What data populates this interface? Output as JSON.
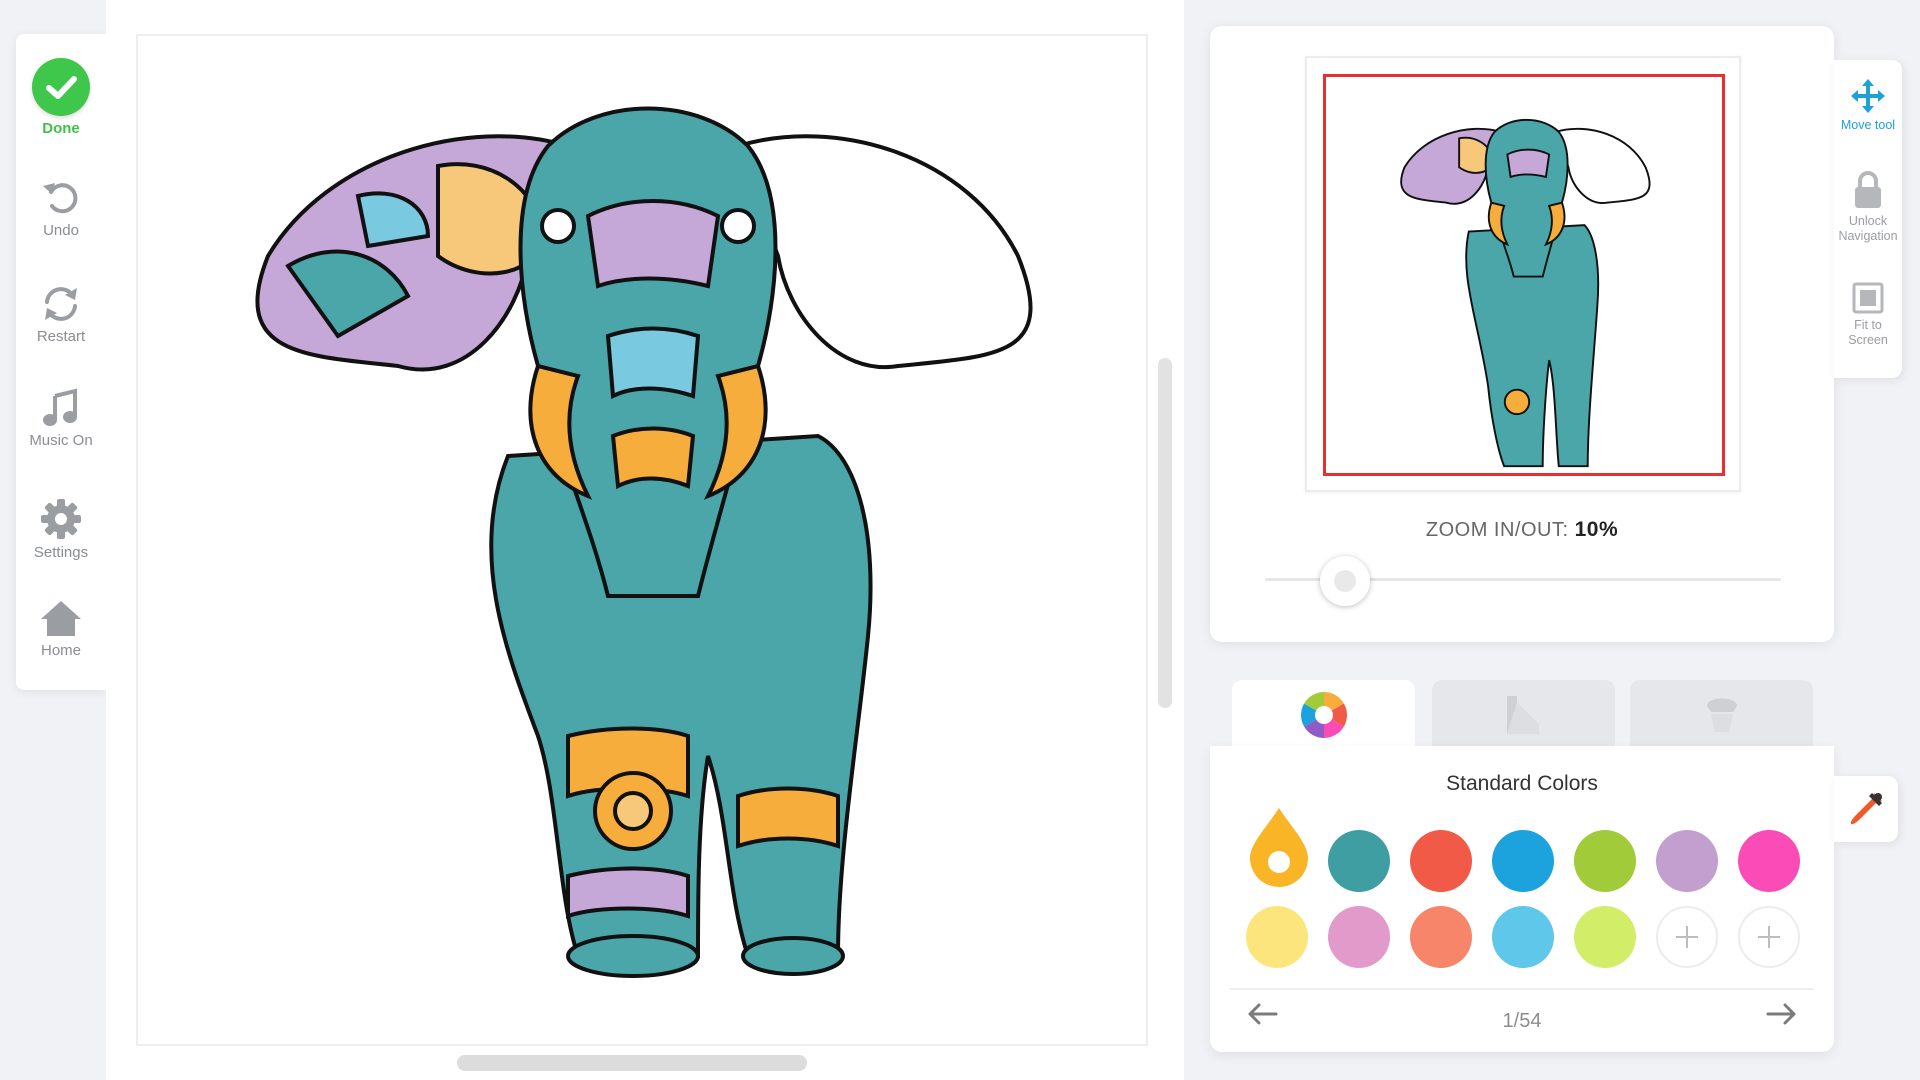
{
  "left_toolbar": {
    "items": [
      {
        "label": "Done",
        "icon": "check-icon"
      },
      {
        "label": "Undo",
        "icon": "undo-icon"
      },
      {
        "label": "Restart",
        "icon": "restart-icon"
      },
      {
        "label": "Music On",
        "icon": "music-icon"
      },
      {
        "label": "Settings",
        "icon": "gear-icon"
      },
      {
        "label": "Home",
        "icon": "home-icon"
      }
    ]
  },
  "navigator": {
    "zoom_label": "ZOOM IN/OUT:",
    "zoom_value": "10%",
    "zoom_fraction": 0.1
  },
  "right_tools": {
    "items": [
      {
        "label": "Move tool",
        "icon": "move-icon"
      },
      {
        "label": "Unlock Navigation",
        "icon": "lock-icon"
      },
      {
        "label": "Fit to Screen",
        "icon": "fit-screen-icon"
      }
    ]
  },
  "tabs": [
    {
      "name": "color-wheel",
      "icon": "color-wheel-icon",
      "active": true
    },
    {
      "name": "gradients",
      "icon": "gradient-icon",
      "active": false
    },
    {
      "name": "textures",
      "icon": "chef-icon",
      "active": false
    }
  ],
  "palette": {
    "title": "Standard Colors",
    "selected": "#f9b526",
    "colors": [
      "#f9b526",
      "#3f9ea1",
      "#f05a46",
      "#1ca2dc",
      "#a2cb39",
      "#c39fd0",
      "#fb4bb7",
      "#fde57d",
      "#e19ac9",
      "#f6856a",
      "#5ec7ea",
      "#d2ee69"
    ],
    "page": "1/54"
  },
  "colors": {
    "accent_green": "#3fc74c",
    "accent_blue": "#1ea0d8",
    "viewport_red": "#e8302f"
  }
}
